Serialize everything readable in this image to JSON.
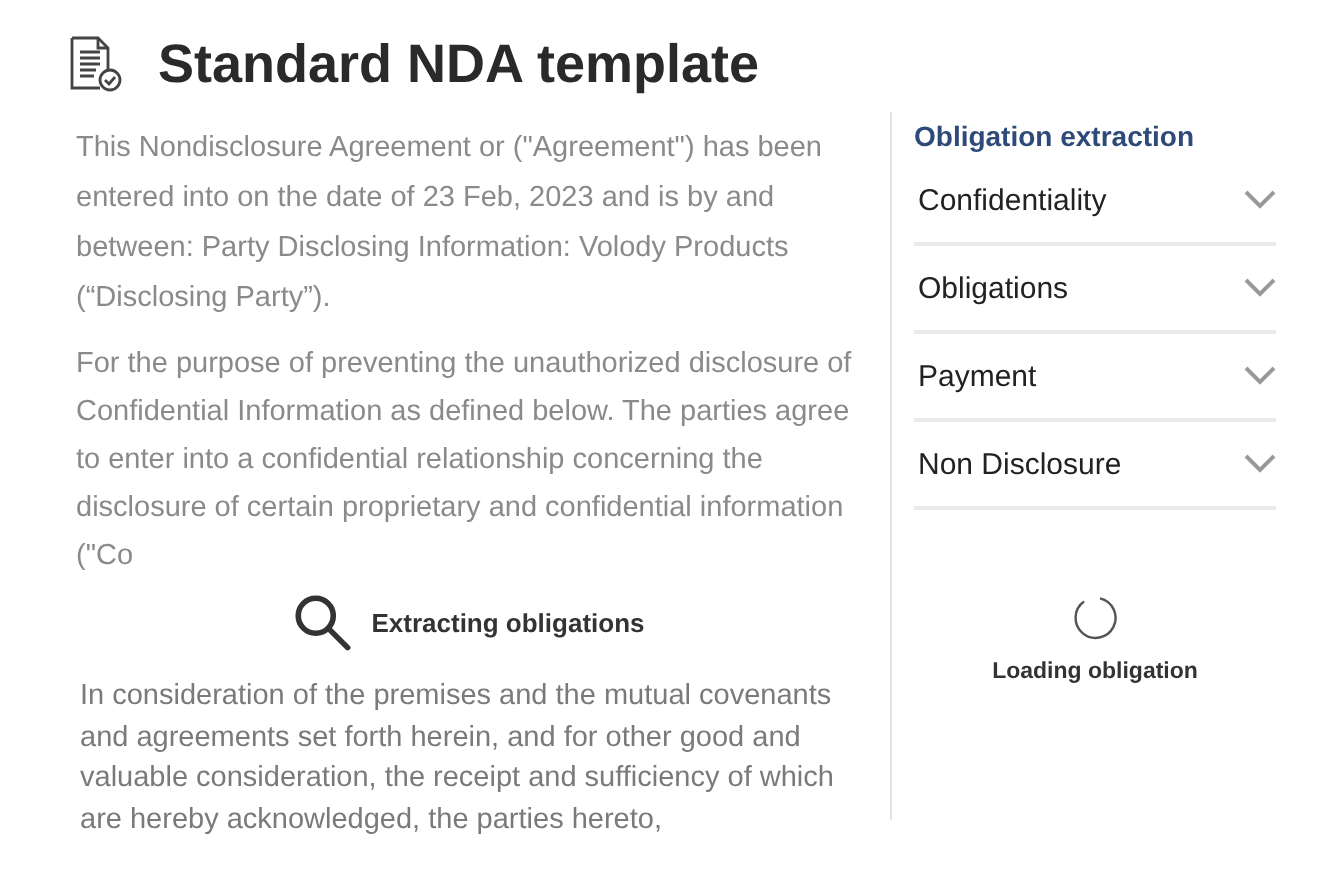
{
  "header": {
    "title": "Standard NDA template"
  },
  "document": {
    "paragraphs": [
      "This Nondisclosure Agreement or (\"Agreement\") has been entered into on the date of 23 Feb, 2023  and is by and between: Party Disclosing Information:   Volody Products (“Disclosing Party”).",
      "For the purpose of preventing the unauthorized disclosure of Confidential Information as defined below. The parties agree to enter into a confidential relationship concerning the disclosure of certain proprietary and confidential information (\"Co",
      "In consideration of the premises and the mutual covenants and agreements set forth herein, and for other good and valuable consideration, the receipt and sufficiency of which are hereby acknowledged, the parties hereto,"
    ],
    "overlay": {
      "label": "Extracting obligations"
    }
  },
  "panel": {
    "title": "Obligation extraction",
    "items": [
      {
        "label": "Confidentiality",
        "expanded": false
      },
      {
        "label": "Obligations",
        "expanded": false
      },
      {
        "label": "Payment",
        "expanded": false
      },
      {
        "label": "Non Disclosure",
        "expanded": false
      }
    ],
    "loading": {
      "label": "Loading obligation"
    }
  }
}
